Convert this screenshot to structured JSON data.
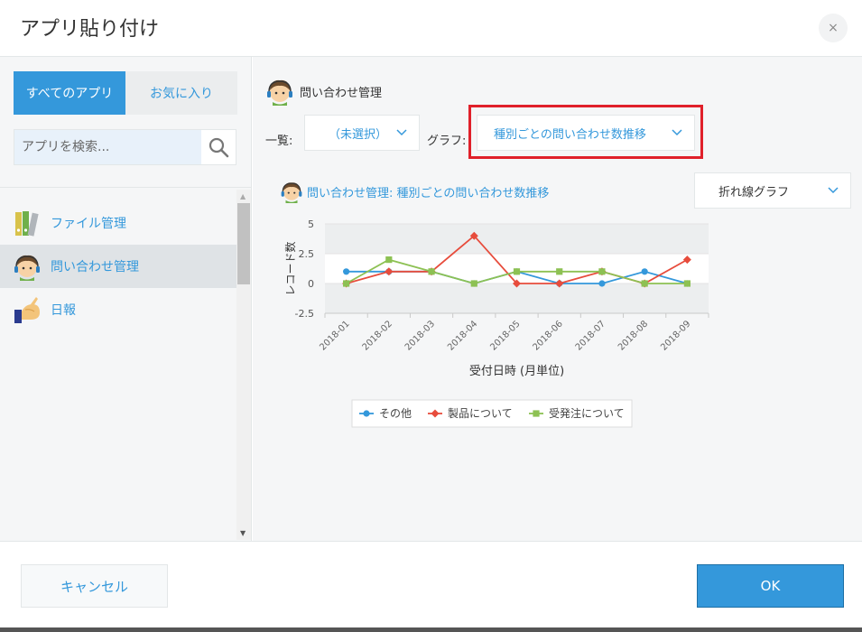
{
  "dialog": {
    "title": "アプリ貼り付け",
    "close_label": "×"
  },
  "left": {
    "tabs": [
      {
        "label": "すべてのアプリ",
        "active": true
      },
      {
        "label": "お気に入り",
        "active": false
      }
    ],
    "search": {
      "placeholder": "アプリを検索...",
      "value": ""
    },
    "apps": [
      {
        "label": "ファイル管理",
        "icon": "binders-icon",
        "selected": false
      },
      {
        "label": "問い合わせ管理",
        "icon": "headset-person-icon",
        "selected": true
      },
      {
        "label": "日報",
        "icon": "hand-book-icon",
        "selected": false
      }
    ]
  },
  "right": {
    "app_name": "問い合わせ管理",
    "view_label": "一覧:",
    "view_value": "（未選択）",
    "graph_label": "グラフ:",
    "graph_value": "種別ごとの問い合わせ数推移",
    "chart_title": "問い合わせ管理: 種別ごとの問い合わせ数推移",
    "chart_type_value": "折れ線グラフ"
  },
  "chart_data": {
    "type": "line",
    "x": [
      "2018-01",
      "2018-02",
      "2018-03",
      "2018-04",
      "2018-05",
      "2018-06",
      "2018-07",
      "2018-08",
      "2018-09"
    ],
    "xlabel": "受付日時 (月単位)",
    "ylabel": "レコード数",
    "ylim": [
      -2.5,
      5
    ],
    "yticks": [
      "5",
      "2.5",
      "0",
      "-2.5"
    ],
    "grid": true,
    "legend_position": "bottom",
    "series": [
      {
        "name": "その他",
        "color": "#3498db",
        "marker": "circle",
        "values": [
          1,
          1,
          1,
          0,
          1,
          0,
          0,
          1,
          0
        ]
      },
      {
        "name": "製品について",
        "color": "#e74c3c",
        "marker": "diamond",
        "values": [
          0,
          1,
          1,
          4,
          0,
          0,
          1,
          0,
          2
        ]
      },
      {
        "name": "受発注について",
        "color": "#8dc153",
        "marker": "square",
        "values": [
          0,
          2,
          1,
          0,
          1,
          1,
          1,
          0,
          0
        ]
      }
    ]
  },
  "footer": {
    "cancel_label": "キャンセル",
    "ok_label": "OK"
  },
  "colors": {
    "accent": "#3498db",
    "highlight": "#e0202a"
  }
}
